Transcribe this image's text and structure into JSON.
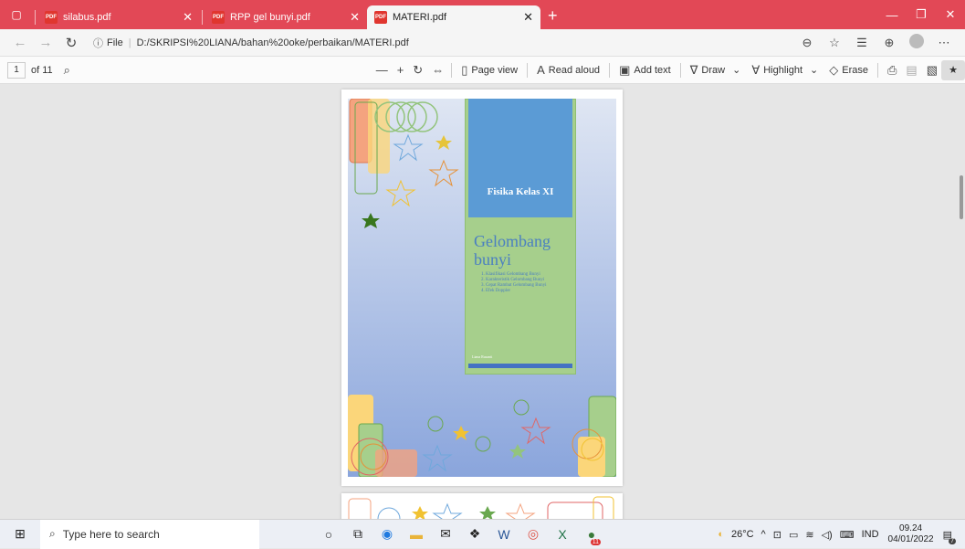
{
  "tabs": [
    {
      "label": "silabus.pdf",
      "active": false
    },
    {
      "label": "RPP gel bunyi.pdf",
      "active": false
    },
    {
      "label": "MATERI.pdf",
      "active": true
    }
  ],
  "address": {
    "prefix": "File",
    "url": "D:/SKRIPSI%20LIANA/bahan%20oke/perbaikan/MATERI.pdf"
  },
  "pdf_toolbar": {
    "page": "1",
    "of": "of 11",
    "page_view": "Page view",
    "read_aloud": "Read aloud",
    "add_text": "Add text",
    "draw": "Draw",
    "highlight": "Highlight",
    "erase": "Erase"
  },
  "cover": {
    "subject": "Fisika Kelas XI",
    "title_line1": "Gelombang",
    "title_line2": "bunyi",
    "topics": [
      "1.  Klasifikasi Gelombang Bunyi",
      "2.  Karakteristik Gelombang Bunyi",
      "3.  Cepat Rambat Gelombang Bunyi",
      "4.  Efek Doppler"
    ],
    "author": "Liana Rusanti"
  },
  "taskbar": {
    "search_placeholder": "Type here to search",
    "temp": "26°C",
    "lang": "IND",
    "time": "09.24",
    "date": "04/01/2022",
    "notif_count": "7",
    "badge": "11"
  },
  "colors": {
    "titlebar": "#e24856",
    "cover_green": "#a6cf8c",
    "cover_blue": "#5b9bd5"
  }
}
